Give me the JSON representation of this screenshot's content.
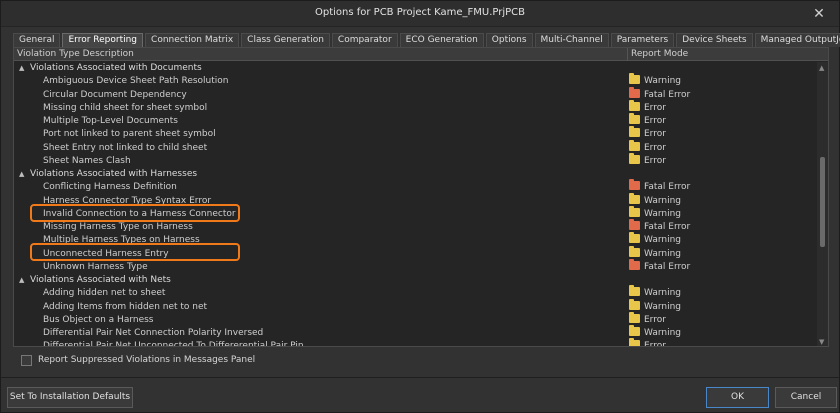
{
  "window": {
    "title": "Options for PCB Project Kame_FMU.PrjPCB",
    "close_glyph": "✕"
  },
  "tabs": [
    {
      "label": "General",
      "active": false
    },
    {
      "label": "Error Reporting",
      "active": true
    },
    {
      "label": "Connection Matrix",
      "active": false
    },
    {
      "label": "Class Generation",
      "active": false
    },
    {
      "label": "Comparator",
      "active": false
    },
    {
      "label": "ECO Generation",
      "active": false
    },
    {
      "label": "Options",
      "active": false
    },
    {
      "label": "Multi-Channel",
      "active": false
    },
    {
      "label": "Parameters",
      "active": false
    },
    {
      "label": "Device Sheets",
      "active": false
    },
    {
      "label": "Managed OutputJobs",
      "active": false
    }
  ],
  "table": {
    "columns": [
      "Violation Type Description",
      "Report Mode"
    ],
    "rows": [
      {
        "type": "group",
        "label": "Violations Associated with Documents"
      },
      {
        "type": "item",
        "label": "Ambiguous Device Sheet Path Resolution",
        "mode": "Warning",
        "color": "yellow"
      },
      {
        "type": "item",
        "label": "Circular Document Dependency",
        "mode": "Fatal Error",
        "color": "orange"
      },
      {
        "type": "item",
        "label": "Missing child sheet for sheet symbol",
        "mode": "Error",
        "color": "yellow"
      },
      {
        "type": "item",
        "label": "Multiple Top-Level Documents",
        "mode": "Error",
        "color": "yellow"
      },
      {
        "type": "item",
        "label": "Port not linked to parent sheet symbol",
        "mode": "Error",
        "color": "yellow"
      },
      {
        "type": "item",
        "label": "Sheet Entry not linked to child sheet",
        "mode": "Error",
        "color": "yellow"
      },
      {
        "type": "item",
        "label": "Sheet Names Clash",
        "mode": "Error",
        "color": "yellow"
      },
      {
        "type": "group",
        "label": "Violations Associated with Harnesses"
      },
      {
        "type": "item",
        "label": "Conflicting Harness Definition",
        "mode": "Fatal Error",
        "color": "orange"
      },
      {
        "type": "item",
        "label": "Harness Connector Type Syntax Error",
        "mode": "Warning",
        "color": "yellow"
      },
      {
        "type": "item",
        "label": "Invalid Connection to a Harness Connector",
        "mode": "Warning",
        "color": "yellow"
      },
      {
        "type": "item",
        "label": "Missing Harness Type on Harness",
        "mode": "Fatal Error",
        "color": "orange"
      },
      {
        "type": "item",
        "label": "Multiple Harness Types on Harness",
        "mode": "Warning",
        "color": "yellow"
      },
      {
        "type": "item",
        "label": "Unconnected Harness Entry",
        "mode": "Warning",
        "color": "yellow"
      },
      {
        "type": "item",
        "label": "Unknown Harness Type",
        "mode": "Fatal Error",
        "color": "orange"
      },
      {
        "type": "group",
        "label": "Violations Associated with Nets"
      },
      {
        "type": "item",
        "label": "Adding hidden net to sheet",
        "mode": "Warning",
        "color": "yellow"
      },
      {
        "type": "item",
        "label": "Adding Items from hidden net to net",
        "mode": "Warning",
        "color": "yellow"
      },
      {
        "type": "item",
        "label": "Bus Object on a Harness",
        "mode": "Error",
        "color": "yellow"
      },
      {
        "type": "item",
        "label": "Differential Pair Net Connection Polarity Inversed",
        "mode": "Warning",
        "color": "yellow"
      },
      {
        "type": "item",
        "label": "Differential Pair Net Unconnected To Differerential Pair Pin",
        "mode": "Error",
        "color": "yellow"
      }
    ]
  },
  "options": {
    "report_suppressed_label": "Report Suppressed Violations in Messages Panel",
    "report_suppressed_checked": false
  },
  "buttons": {
    "defaults": "Set To Installation Defaults",
    "ok": "OK",
    "cancel": "Cancel"
  },
  "colors": {
    "highlight": "#f07a1a",
    "warning_folder": "#e8c64a",
    "fatal_folder": "#e06a4a"
  }
}
